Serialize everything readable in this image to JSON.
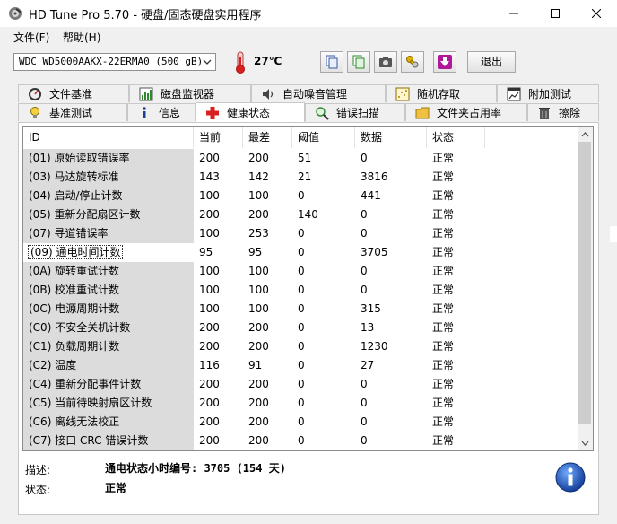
{
  "window": {
    "title": "HD Tune Pro 5.70 - 硬盘/固态硬盘实用程序"
  },
  "menu": {
    "file": "文件(F)",
    "help": "帮助(H)"
  },
  "toolbar": {
    "drive": "WDC WD5000AAKX-22ERMA0 (500 gB)",
    "temperature": "27℃",
    "exit_label": "退出"
  },
  "tabs_top": [
    "文件基准",
    "磁盘监视器",
    "自动噪音管理",
    "随机存取",
    "附加测试"
  ],
  "tabs_bottom": [
    "基准测试",
    "信息",
    "健康状态",
    "错误扫描",
    "文件夹占用率",
    "擦除"
  ],
  "table": {
    "columns": [
      "ID",
      "当前",
      "最差",
      "阈值",
      "数据",
      "状态"
    ],
    "rows": [
      [
        "(01) 原始读取错误率",
        "200",
        "200",
        "51",
        "0",
        "正常"
      ],
      [
        "(03) 马达旋转标准",
        "143",
        "142",
        "21",
        "3816",
        "正常"
      ],
      [
        "(04) 启动/停止计数",
        "100",
        "100",
        "0",
        "441",
        "正常"
      ],
      [
        "(05) 重新分配扇区计数",
        "200",
        "200",
        "140",
        "0",
        "正常"
      ],
      [
        "(07) 寻道错误率",
        "100",
        "253",
        "0",
        "0",
        "正常"
      ],
      [
        "(09) 通电时间计数",
        "95",
        "95",
        "0",
        "3705",
        "正常"
      ],
      [
        "(0A) 旋转重试计数",
        "100",
        "100",
        "0",
        "0",
        "正常"
      ],
      [
        "(0B) 校准重试计数",
        "100",
        "100",
        "0",
        "0",
        "正常"
      ],
      [
        "(0C) 电源周期计数",
        "100",
        "100",
        "0",
        "315",
        "正常"
      ],
      [
        "(C0) 不安全关机计数",
        "200",
        "200",
        "0",
        "13",
        "正常"
      ],
      [
        "(C1) 负载周期计数",
        "200",
        "200",
        "0",
        "1230",
        "正常"
      ],
      [
        "(C2) 温度",
        "116",
        "91",
        "0",
        "27",
        "正常"
      ],
      [
        "(C4) 重新分配事件计数",
        "200",
        "200",
        "0",
        "0",
        "正常"
      ],
      [
        "(C5) 当前待映射扇区计数",
        "200",
        "200",
        "0",
        "0",
        "正常"
      ],
      [
        "(C6) 离线无法校正",
        "200",
        "200",
        "0",
        "0",
        "正常"
      ],
      [
        "(C7) 接口 CRC 错误计数",
        "200",
        "200",
        "0",
        "0",
        "正常"
      ]
    ],
    "selected_index": 5
  },
  "details": {
    "description_label": "描述:",
    "description_value": "通电状态小时编号: 3705 (154 天)",
    "status_label": "状态:",
    "status_value": "正常"
  },
  "colors": {
    "accent_red": "#d92020",
    "id_column_bg": "#dcdcdc",
    "info_blue": "#1f5fbf"
  }
}
